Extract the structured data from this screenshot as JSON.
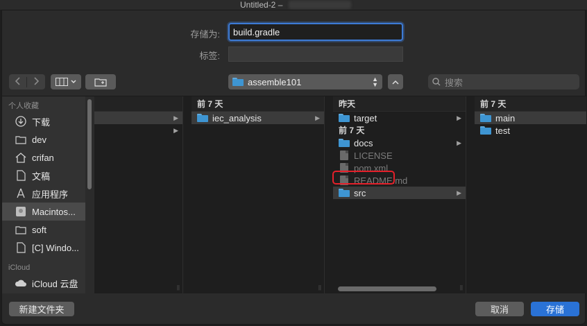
{
  "window": {
    "title": "Untitled-2 –"
  },
  "form": {
    "save_as_label": "存储为:",
    "save_as_value": "build.gradle",
    "tags_label": "标签:"
  },
  "toolbar": {
    "location": "assemble101",
    "search_placeholder": "搜索"
  },
  "sidebar": {
    "favorites_header": "个人收藏",
    "favorites": [
      {
        "label": "下载",
        "icon": "download-icon"
      },
      {
        "label": "dev",
        "icon": "folder-icon"
      },
      {
        "label": "crifan",
        "icon": "home-icon"
      },
      {
        "label": "文稿",
        "icon": "document-icon"
      },
      {
        "label": "应用程序",
        "icon": "applications-icon"
      },
      {
        "label": "Macintos...",
        "icon": "disk-icon"
      },
      {
        "label": "soft",
        "icon": "folder-icon"
      },
      {
        "label": "[C] Windo...",
        "icon": "document-icon"
      }
    ],
    "icloud_header": "iCloud",
    "icloud_items": [
      {
        "label": "iCloud 云盘",
        "icon": "cloud-icon"
      }
    ]
  },
  "columns": {
    "col2": {
      "header": "前 7 天",
      "items": [
        "iec_analysis"
      ]
    },
    "col3": {
      "header": "昨天",
      "items_yesterday": [
        "target"
      ],
      "subheader": "前 7 天",
      "items_week": [
        {
          "name": "docs",
          "type": "folder"
        },
        {
          "name": "LICENSE",
          "type": "file"
        },
        {
          "name": "pom.xml",
          "type": "file"
        },
        {
          "name": "README.md",
          "type": "file"
        },
        {
          "name": "src",
          "type": "folder"
        }
      ]
    },
    "col4": {
      "header": "前 7 天",
      "items": [
        "main",
        "test"
      ]
    }
  },
  "buttons": {
    "new_folder": "新建文件夹",
    "cancel": "取消",
    "save": "存储"
  },
  "colors": {
    "accent": "#2a72d6",
    "highlight": "#e5202a",
    "folder": "#3e95d2"
  }
}
